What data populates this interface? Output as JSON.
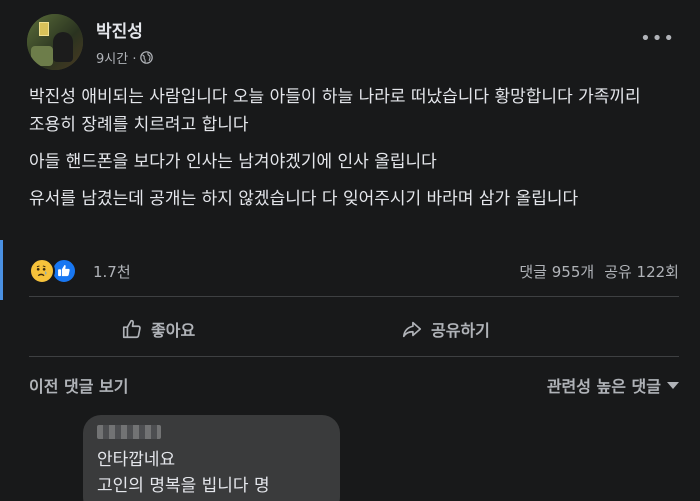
{
  "post": {
    "author": "박진성",
    "time": "9시간 ·",
    "paragraphs": [
      "박진성 애비되는 사람입니다 오늘 아들이 하늘 나라로 떠났습니다 황망합니다 가족끼리 조용히 장례를 치르려고 합니다",
      "아들 핸드폰을 보다가 인사는 남겨야겠기에 인사 올립니다",
      "유서를 남겼는데 공개는 하지 않겠습니다 다 잊어주시기 바라며 삼가 올립니다"
    ]
  },
  "reactions": {
    "count": "1.7천",
    "icons": [
      "sad-icon",
      "like-icon"
    ],
    "comments": "댓글 955개",
    "shares": "공유 122회"
  },
  "actions": {
    "like_label": "좋아요",
    "share_label": "공유하기"
  },
  "comments_bar": {
    "prev_label": "이전 댓글 보기",
    "sort_label": "관련성 높은 댓글"
  },
  "comment": {
    "lines": [
      "안타깝네요",
      "고인의 명복을 빕니다 명"
    ]
  },
  "colors": {
    "background": "#18191a",
    "text": "#e4e6eb",
    "muted": "#b0b3b8",
    "like_blue": "#1877f2",
    "sad_yellow": "#f7c33b",
    "bubble": "#3a3b3c"
  }
}
